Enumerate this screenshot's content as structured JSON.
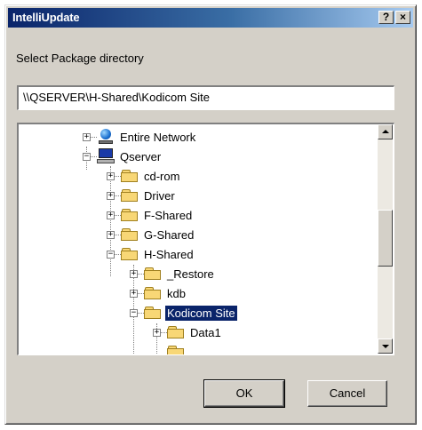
{
  "window": {
    "title": "IntelliUpdate",
    "help_label": "?",
    "close_label": "×"
  },
  "prompt": "Select Package directory",
  "path": "\\\\QSERVER\\H-Shared\\Kodicom Site",
  "tree": {
    "nodes": [
      {
        "label": "Entire Network",
        "icon": "network-icon",
        "expander": "+"
      },
      {
        "label": "Qserver",
        "icon": "server-icon",
        "expander": "−"
      },
      {
        "label": "cd-rom",
        "icon": "folder-icon",
        "expander": "+"
      },
      {
        "label": "Driver",
        "icon": "folder-icon",
        "expander": "+"
      },
      {
        "label": "F-Shared",
        "icon": "folder-icon",
        "expander": "+"
      },
      {
        "label": "G-Shared",
        "icon": "folder-icon",
        "expander": "+"
      },
      {
        "label": "H-Shared",
        "icon": "folder-icon",
        "expander": "−"
      },
      {
        "label": "_Restore",
        "icon": "folder-icon",
        "expander": "+"
      },
      {
        "label": "kdb",
        "icon": "folder-icon",
        "expander": "+"
      },
      {
        "label": "Kodicom Site",
        "icon": "open-folder-icon",
        "expander": "−",
        "selected": true
      },
      {
        "label": "Data1",
        "icon": "folder-icon",
        "expander": "+"
      }
    ]
  },
  "buttons": {
    "ok": "OK",
    "cancel": "Cancel"
  }
}
